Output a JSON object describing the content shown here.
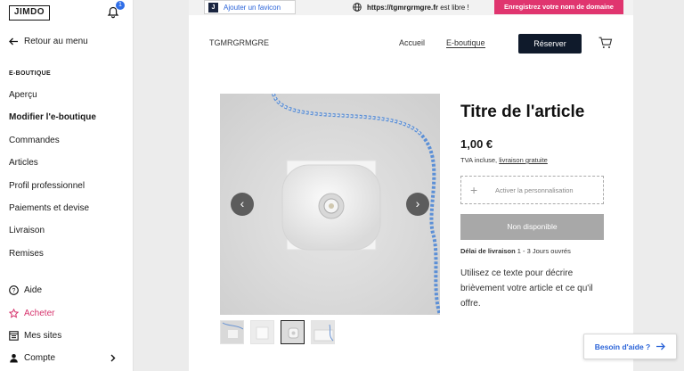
{
  "sidebar": {
    "logo": "JIMDO",
    "notifications": "1",
    "back": "Retour au menu",
    "section_title": "E-BOUTIQUE",
    "items": [
      {
        "label": "Aperçu"
      },
      {
        "label": "Modifier l'e-boutique"
      },
      {
        "label": "Commandes"
      },
      {
        "label": "Articles"
      },
      {
        "label": "Profil professionnel"
      },
      {
        "label": "Paiements et devise"
      },
      {
        "label": "Livraison"
      },
      {
        "label": "Remises"
      }
    ],
    "bottom": {
      "help": "Aide",
      "buy": "Acheter",
      "sites": "Mes sites",
      "account": "Compte"
    }
  },
  "topbar": {
    "favicon_label": "Ajouter un favicon",
    "favicon_letter": "J",
    "domain": "https://tgmrgrmgre.fr",
    "domain_suffix": "est libre !",
    "register_label": "Enregistrez votre nom de domaine"
  },
  "site": {
    "name": "TGMRGRMGRE",
    "nav": [
      "Accueil",
      "E-boutique"
    ],
    "reserve_label": "Réserver"
  },
  "product": {
    "title": "Titre de l'article",
    "price": "1,00 €",
    "tax_text": "TVA incluse,",
    "shipping_link": "livraison gratuite",
    "personalize_label": "Activer la personnalisation",
    "status_button": "Non disponible",
    "delivery_label": "Délai de livraison",
    "delivery_value": "1 - 3 Jours ouvrés",
    "description": "Utilisez ce texte pour décrire brièvement votre article et ce qu'il offre.",
    "prev_arrow": "‹",
    "next_arrow": "›"
  },
  "help_button": "Besoin d'aide ?",
  "colors": {
    "accent_pink": "#e0356f",
    "link_blue": "#2a63d8",
    "reserve_dark": "#0f1a2b",
    "unavailable_gray": "#a8a8a8"
  }
}
